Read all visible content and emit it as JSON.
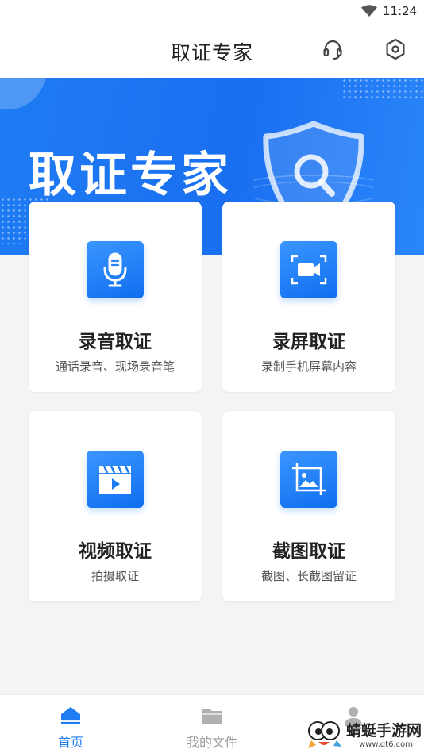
{
  "status_bar": {
    "time": "11:24"
  },
  "header": {
    "title": "取证专家"
  },
  "banner": {
    "title": "取证专家"
  },
  "cards": [
    {
      "title": "录音取证",
      "subtitle": "通话录音、现场录音笔",
      "icon": "microphone-icon"
    },
    {
      "title": "录屏取证",
      "subtitle": "录制手机屏幕内容",
      "icon": "video-camera-icon"
    },
    {
      "title": "视频取证",
      "subtitle": "拍摄取证",
      "icon": "clapperboard-icon"
    },
    {
      "title": "截图取证",
      "subtitle": "截图、长截图留证",
      "icon": "image-icon"
    }
  ],
  "bottom_nav": {
    "items": [
      {
        "label": "首页",
        "icon": "home-icon",
        "active": true
      },
      {
        "label": "我的文件",
        "icon": "folder-icon",
        "active": false
      },
      {
        "label": "",
        "icon": "user-icon",
        "active": false
      }
    ],
    "active_color": "#1f7cf3",
    "inactive_color": "#9a9a9a"
  },
  "watermark": {
    "text": "蜻蜓手游网",
    "url": "www.qt6.com"
  },
  "colors": {
    "brand": "#1f7cf3",
    "background": "#f3f4f6"
  }
}
